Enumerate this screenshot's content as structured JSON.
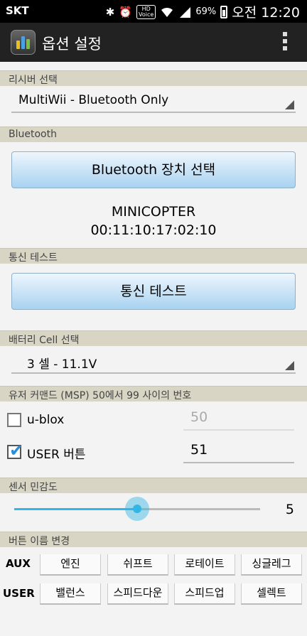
{
  "status": {
    "carrier": "SKT",
    "hd_label": "HD",
    "voice_label": "Voice",
    "battery_pct": "69%",
    "time": "오전 12:20",
    "icons": [
      "bluetooth-icon",
      "alarm-icon",
      "hd-voice-icon",
      "wifi-icon",
      "signal-icon",
      "battery-icon"
    ]
  },
  "action_bar": {
    "title": "옵션 설정"
  },
  "receiver": {
    "header": "리시버 선택",
    "selected": "MultiWii - Bluetooth Only"
  },
  "bluetooth": {
    "header": "Bluetooth",
    "select_button": "Bluetooth 장치 선택",
    "device_name": "MINICOPTER",
    "device_address": "00:11:10:17:02:10"
  },
  "comm_test": {
    "header": "통신 테스트",
    "button": "통신 테스트"
  },
  "battery": {
    "header": "배터리 Cell 선택",
    "selected": "3 셀 - 11.1V"
  },
  "user_command": {
    "header": "유저 커맨드 (MSP) 50에서 99 사이의 번호",
    "rows": [
      {
        "label": "u-blox",
        "checked": false,
        "value": "50"
      },
      {
        "label": "USER 버튼",
        "checked": true,
        "value": "51"
      }
    ]
  },
  "sensor": {
    "header": "센서 민감도",
    "value": "5",
    "level_fraction": 0.5
  },
  "rename": {
    "header": "버튼 이름 변경",
    "aux_label": "AUX",
    "user_label": "USER",
    "aux_buttons": [
      "엔진",
      "쉬프트",
      "로테이트",
      "싱글레그"
    ],
    "user_buttons": [
      "밸런스",
      "스피드다운",
      "스피드업",
      "셀렉트"
    ]
  },
  "colors": {
    "accent": "#33b5e5",
    "section_header": "#d8d5c4",
    "action_bar": "#222222"
  }
}
